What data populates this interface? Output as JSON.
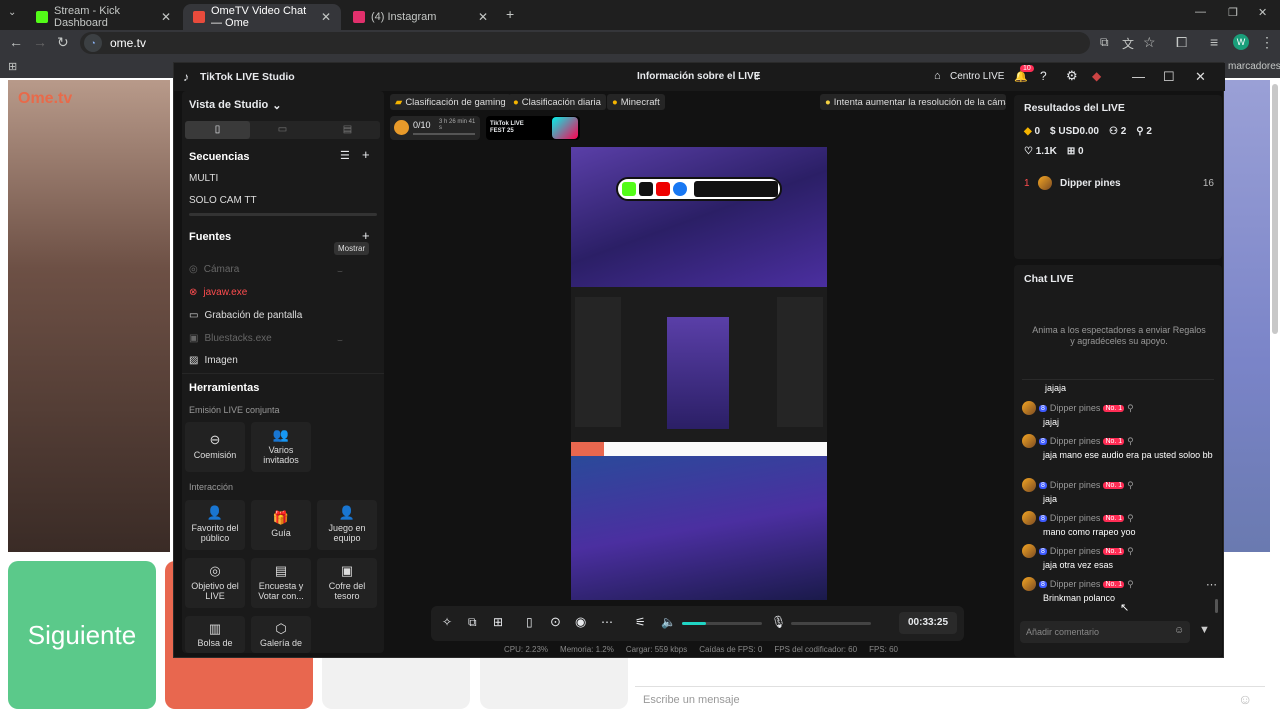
{
  "browser": {
    "tabs": [
      {
        "title": "Stream - Kick Dashboard",
        "color": "#53fc18"
      },
      {
        "title": "OmeTV Video Chat — Ome",
        "color": "#e84b3c"
      },
      {
        "title": "(4) Instagram",
        "color": "#e1306c"
      }
    ],
    "url": "ome.tv",
    "bookmarks_label": "marcadores",
    "profile_initial": "W"
  },
  "ometv": {
    "logo": "Ome.tv",
    "next_button": "Siguiente",
    "message_placeholder": "Escribe un mensaje"
  },
  "studio": {
    "app_title": "TikTok LIVE Studio",
    "live_info": "Información sobre el LIVE",
    "centro_live": "Centro LIVE",
    "notif_count": "10",
    "view_label": "Vista de Studio",
    "sequences_label": "Secuencias",
    "sequences": [
      "MULTI",
      "SOLO CAM TT"
    ],
    "sources_label": "Fuentes",
    "tooltip": "Mostrar",
    "sources": [
      {
        "label": "Cámara",
        "state": "dim"
      },
      {
        "label": "javaw.exe",
        "state": "red"
      },
      {
        "label": "Grabación de pantalla",
        "state": "normal"
      },
      {
        "label": "Bluestacks.exe",
        "state": "dim"
      },
      {
        "label": "Imagen",
        "state": "normal"
      }
    ],
    "tools_label": "Herramientas",
    "joint_label": "Emisión LIVE conjunta",
    "joint_tools": [
      "Coemisión",
      "Varios invitados"
    ],
    "interaction_label": "Interacción",
    "interaction_tools": [
      "Favorito del público",
      "Guía",
      "Juego en equipo",
      "Objetivo del LIVE",
      "Encuesta y Votar con...",
      "Cofre del tesoro",
      "Bolsa de",
      "Galería de"
    ],
    "chips": [
      "Clasificación de gaming",
      "Clasificación diaria",
      "Minecraft"
    ],
    "resolution_tip": "Intenta aumentar la resolución de la cámar...",
    "goal_progress": "0/10",
    "goal_time": "3 h 26 min 41 s",
    "fest_label": "TikTok LIVE FEST 25",
    "timer": "00:33:25",
    "volume_level": 0.3,
    "stats": {
      "cpu": "CPU:  2.23%",
      "memory": "Memoria:  1.2%",
      "upload": "Cargar:  559 kbps",
      "fps_drops": "Caídas de FPS:  0",
      "encoder_fps": "FPS del codificador:  60",
      "fps": "FPS:  60"
    },
    "results": {
      "title": "Resultados del LIVE",
      "diamonds": "0",
      "usd": "USD0.00",
      "viewers": "2",
      "new": "2",
      "likes": "1.1K",
      "gifts": "0",
      "top_rank": "1",
      "top_name": "Dipper pines",
      "top_score": "16"
    },
    "chat": {
      "title": "Chat LIVE",
      "empty_hint": "Anima a los espectadores a enviar Regalos y agradéceles su apoyo.",
      "first_text": "jajaja",
      "messages": [
        {
          "name": "Dipper pines",
          "level": "8",
          "rank": "No. 1",
          "text": "jajaj"
        },
        {
          "name": "Dipper pines",
          "level": "8",
          "rank": "No. 1",
          "text": "jaja mano ese audio era pa usted soloo bb"
        },
        {
          "name": "Dipper pines",
          "level": "8",
          "rank": "No. 1",
          "text": "jaja"
        },
        {
          "name": "Dipper pines",
          "level": "8",
          "rank": "No. 1",
          "text": "mano como rrapeo yoo"
        },
        {
          "name": "Dipper pines",
          "level": "8",
          "rank": "No. 1",
          "text": "jaja otra vez esas"
        },
        {
          "name": "Dipper pines",
          "level": "8",
          "rank": "No. 1",
          "text": "Brinkman polanco"
        }
      ],
      "comment_placeholder": "Añadir comentario"
    }
  }
}
